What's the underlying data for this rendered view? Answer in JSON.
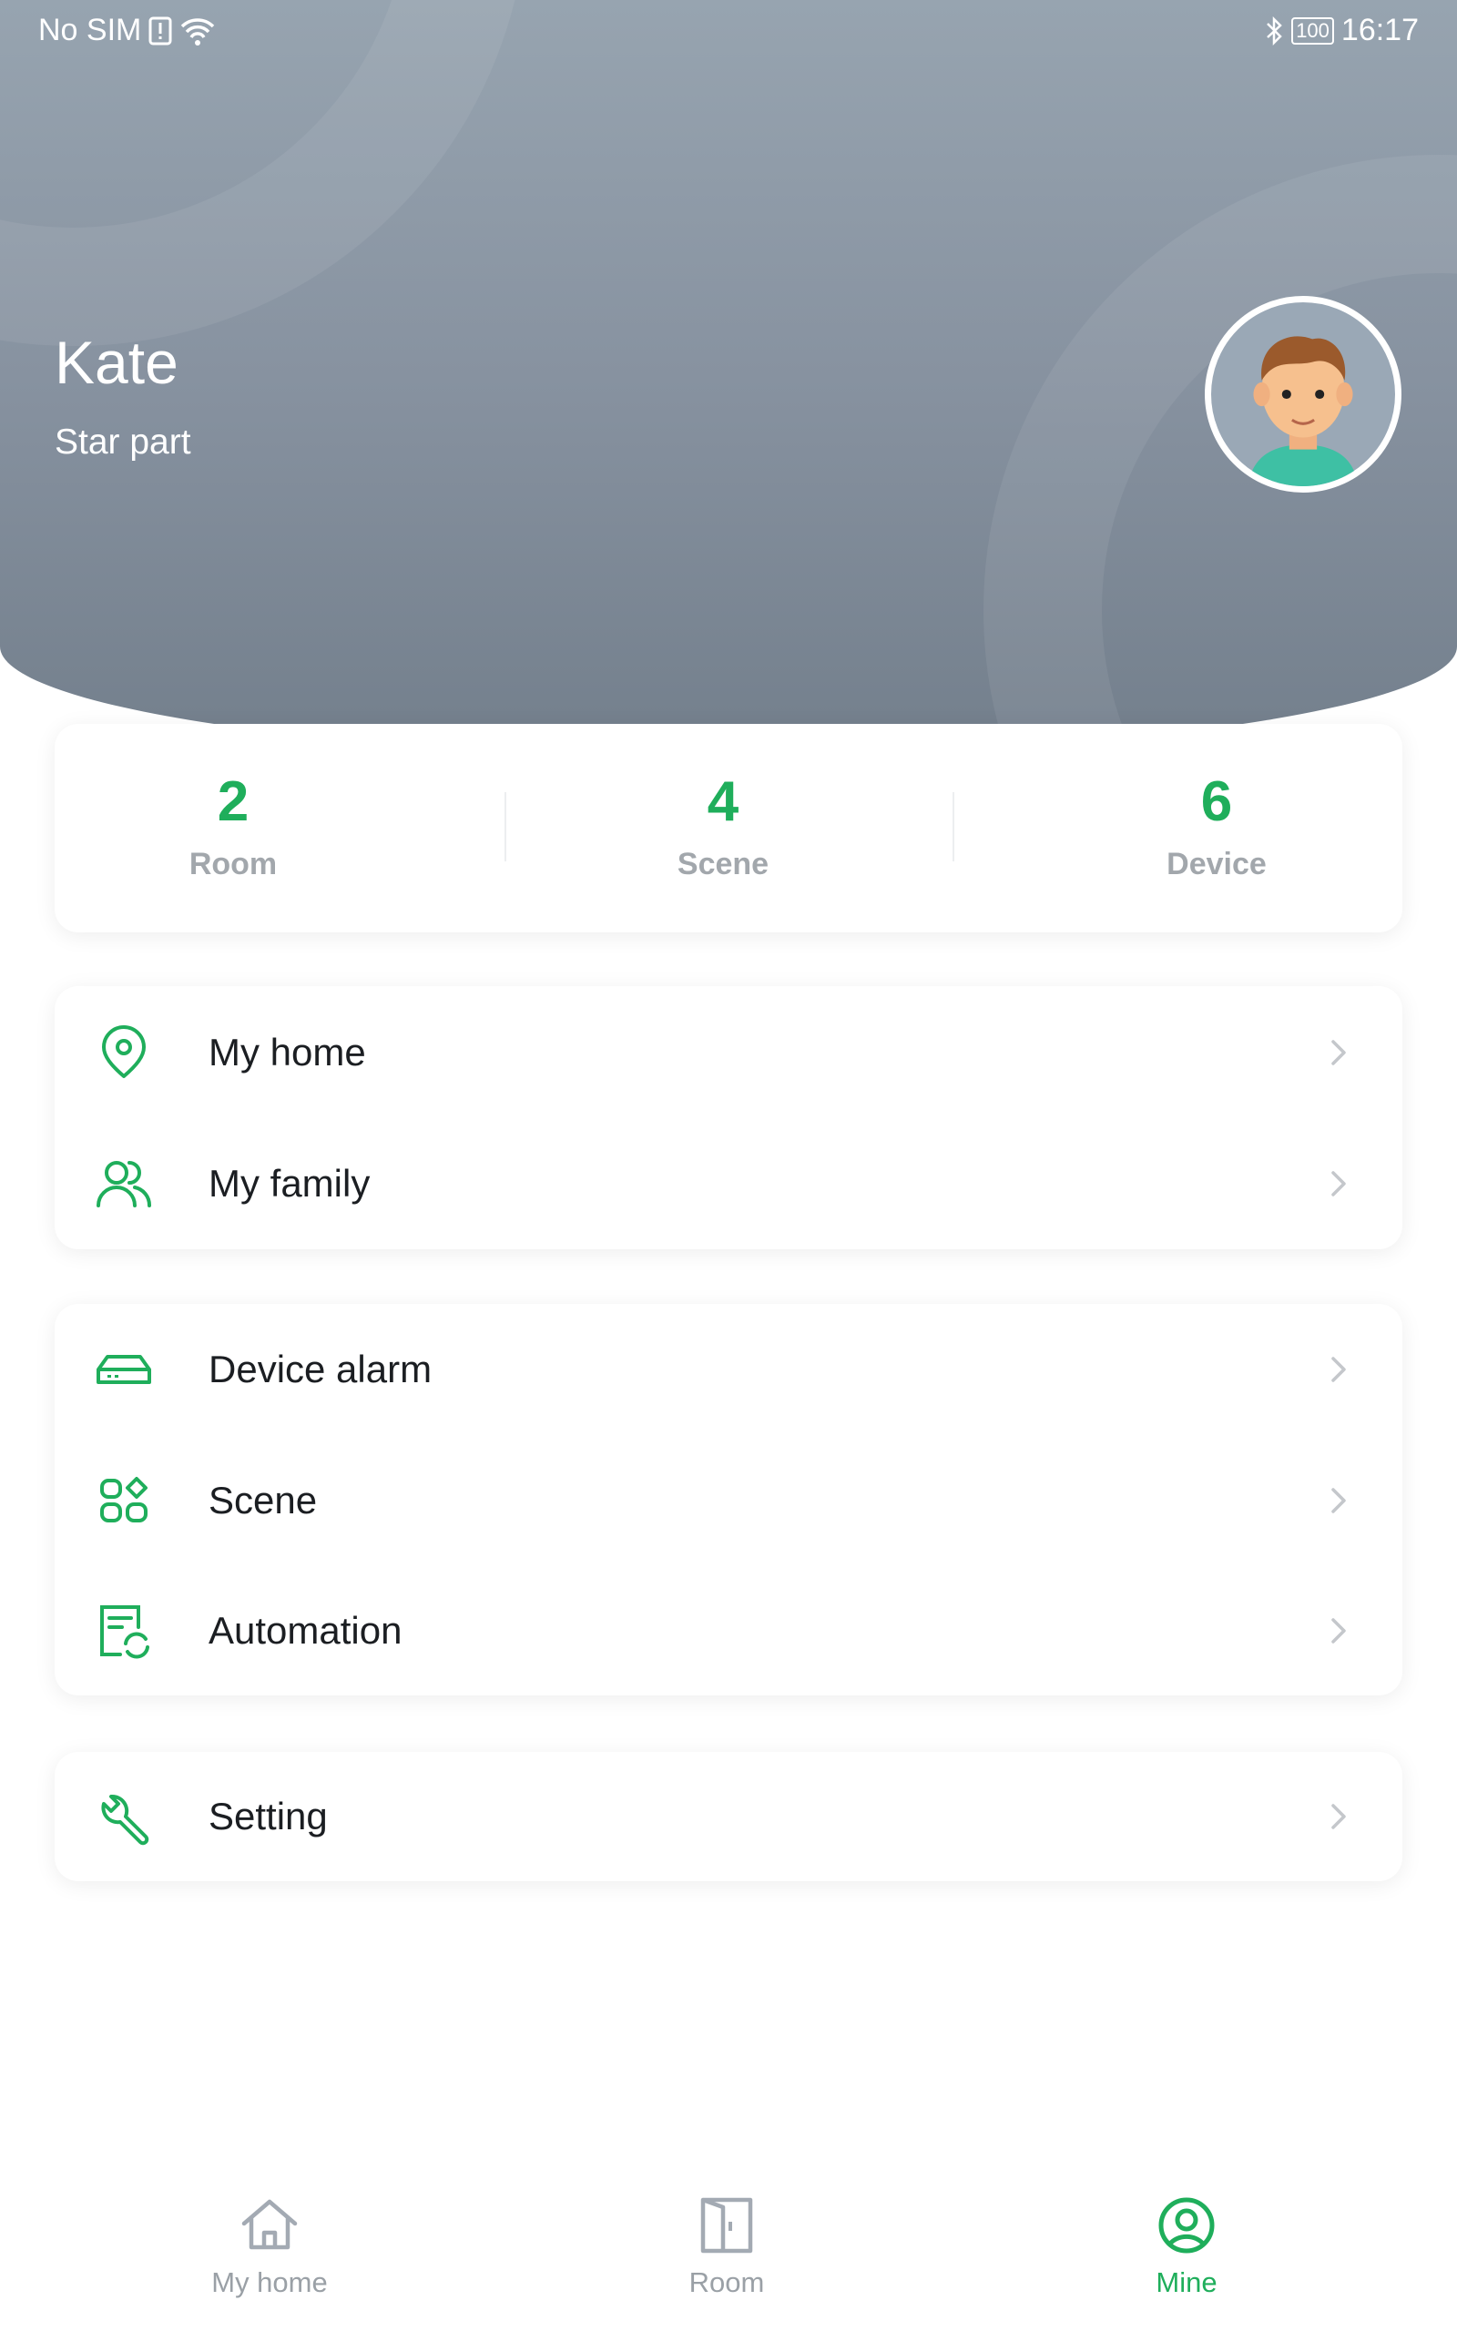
{
  "status_bar": {
    "carrier": "No SIM",
    "battery": "100",
    "time": "16:17"
  },
  "profile": {
    "name": "Kate",
    "subtitle": "Star part"
  },
  "stats": [
    {
      "value": "2",
      "label": "Room"
    },
    {
      "value": "4",
      "label": "Scene"
    },
    {
      "value": "6",
      "label": "Device"
    }
  ],
  "menu_groups": [
    [
      {
        "label": "My home",
        "icon": "location-pin-icon"
      },
      {
        "label": "My family",
        "icon": "family-icon"
      }
    ],
    [
      {
        "label": "Device alarm",
        "icon": "device-icon"
      },
      {
        "label": "Scene",
        "icon": "scene-grid-icon"
      },
      {
        "label": "Automation",
        "icon": "automation-icon"
      }
    ],
    [
      {
        "label": "Setting",
        "icon": "wrench-icon"
      }
    ]
  ],
  "bottom_nav": [
    {
      "label": "My home",
      "icon": "home-icon"
    },
    {
      "label": "Room",
      "icon": "door-icon"
    },
    {
      "label": "Mine",
      "icon": "user-circle-icon",
      "active": true
    }
  ],
  "colors": {
    "accent": "#1fae5b",
    "inactive": "#9aa0a6"
  }
}
